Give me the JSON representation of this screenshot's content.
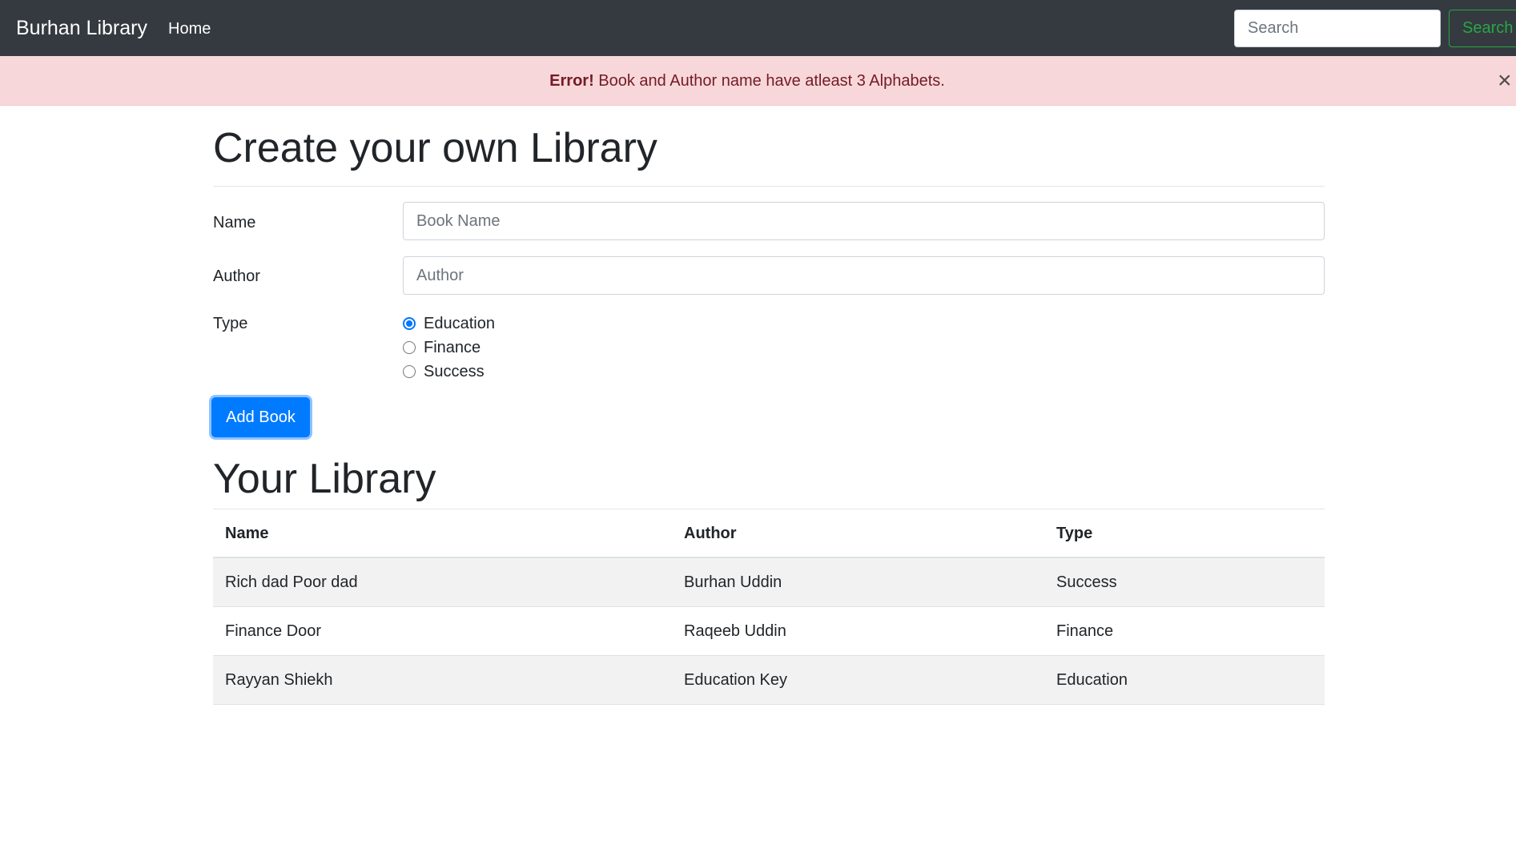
{
  "navbar": {
    "brand": "Burhan Library",
    "home_label": "Home",
    "search_placeholder": "Search",
    "search_button": "Search"
  },
  "alert": {
    "strong": "Error!",
    "message": " Book and Author name have atleast 3 Alphabets.",
    "close": "×"
  },
  "form": {
    "title": "Create your own Library",
    "name_label": "Name",
    "name_placeholder": "Book Name",
    "author_label": "Author",
    "author_placeholder": "Author",
    "type_label": "Type",
    "type_options": [
      "Education",
      "Finance",
      "Success"
    ],
    "selected_type": "Education",
    "submit_label": "Add Book"
  },
  "library": {
    "title": "Your Library",
    "columns": [
      "Name",
      "Author",
      "Type"
    ],
    "rows": [
      [
        "Rich dad Poor dad",
        "Burhan Uddin",
        "Success"
      ],
      [
        "Finance Door",
        "Raqeeb Uddin",
        "Finance"
      ],
      [
        "Rayyan Shiekh",
        "Education Key",
        "Education"
      ]
    ]
  },
  "colors": {
    "navbar_bg": "#343a40",
    "alert_bg": "#f8d7da",
    "alert_text": "#721c24",
    "primary": "#007bff",
    "success": "#28a745"
  }
}
